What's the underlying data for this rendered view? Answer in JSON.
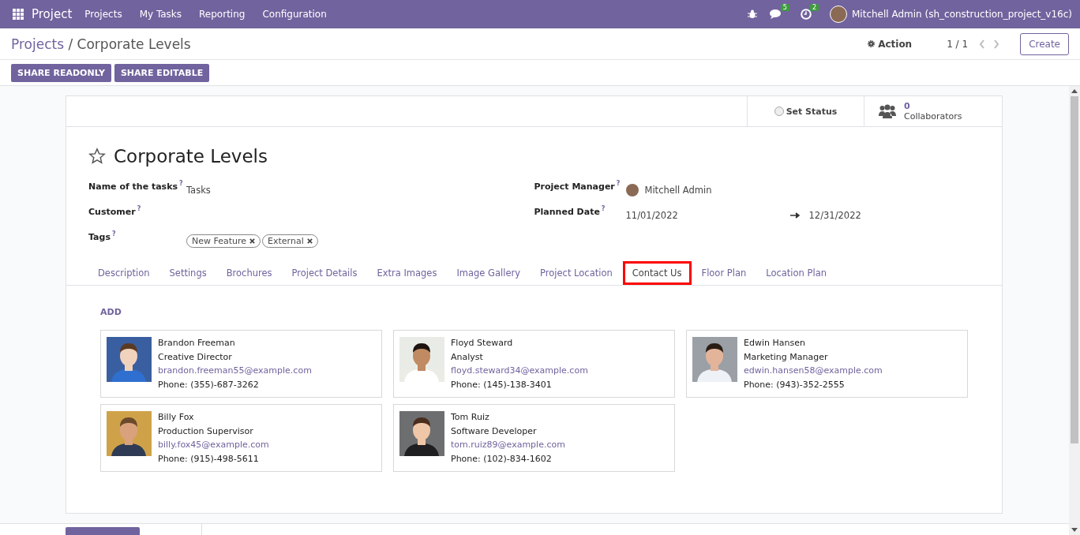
{
  "navbar": {
    "app": "Project",
    "menu": [
      "Projects",
      "My Tasks",
      "Reporting",
      "Configuration"
    ],
    "messages_count": "5",
    "activities_count": "2",
    "user": "Mitchell Admin (sh_construction_project_v16c)"
  },
  "breadcrumb": {
    "parent": "Projects",
    "separator": "/",
    "current": "Corporate Levels"
  },
  "control_panel": {
    "action": "Action",
    "pager": "1 / 1",
    "create": "Create",
    "buttons": [
      "SHARE READONLY",
      "SHARE EDITABLE"
    ]
  },
  "stat_buttons": [
    {
      "kind": "status",
      "label": "Set Status"
    },
    {
      "kind": "count",
      "value": "0",
      "label": "Collaborators"
    }
  ],
  "title": "Corporate Levels",
  "favorite": false,
  "fields_left": [
    {
      "kind": "text",
      "label": "Name of the tasks",
      "help": "?",
      "value": "Tasks"
    },
    {
      "kind": "text",
      "label": "Customer",
      "help": "?"
    },
    {
      "kind": "tags",
      "label": "Tags",
      "help": "?",
      "tags": [
        "New Feature",
        "External"
      ]
    }
  ],
  "fields_right": [
    {
      "kind": "user",
      "label": "Project Manager",
      "help": "?",
      "value": "Mitchell Admin"
    },
    {
      "kind": "range",
      "label": "Planned Date",
      "help": "?",
      "start": "11/01/2022",
      "end": "12/31/2022"
    }
  ],
  "tabs": [
    {
      "label": "Description",
      "selected": false
    },
    {
      "label": "Settings",
      "selected": false
    },
    {
      "label": "Brochures",
      "selected": false
    },
    {
      "label": "Project Details",
      "selected": false
    },
    {
      "label": "Extra Images",
      "selected": false
    },
    {
      "label": "Image Gallery",
      "selected": false
    },
    {
      "label": "Project Location",
      "selected": false
    },
    {
      "label": "Contact Us",
      "selected": true
    },
    {
      "label": "Floor Plan",
      "selected": false
    },
    {
      "label": "Location Plan",
      "selected": false
    }
  ],
  "add_link": "ADD",
  "contacts": [
    {
      "name": "Brandon Freeman",
      "role": "Creative Director",
      "email": "brandon.freeman55@example.com",
      "phone": "Phone: (355)-687-3262"
    },
    {
      "name": "Floyd Steward",
      "role": "Analyst",
      "email": "floyd.steward34@example.com",
      "phone": "Phone: (145)-138-3401"
    },
    {
      "name": "Edwin Hansen",
      "role": "Marketing Manager",
      "email": "edwin.hansen58@example.com",
      "phone": "Phone: (943)-352-2555"
    },
    {
      "name": "Billy Fox",
      "role": "Production Supervisor",
      "email": "billy.fox45@example.com",
      "phone": "Phone: (915)-498-5611"
    },
    {
      "name": "Tom Ruiz",
      "role": "Software Developer",
      "email": "tom.ruiz89@example.com",
      "phone": "Phone: (102)-834-1602"
    }
  ]
}
